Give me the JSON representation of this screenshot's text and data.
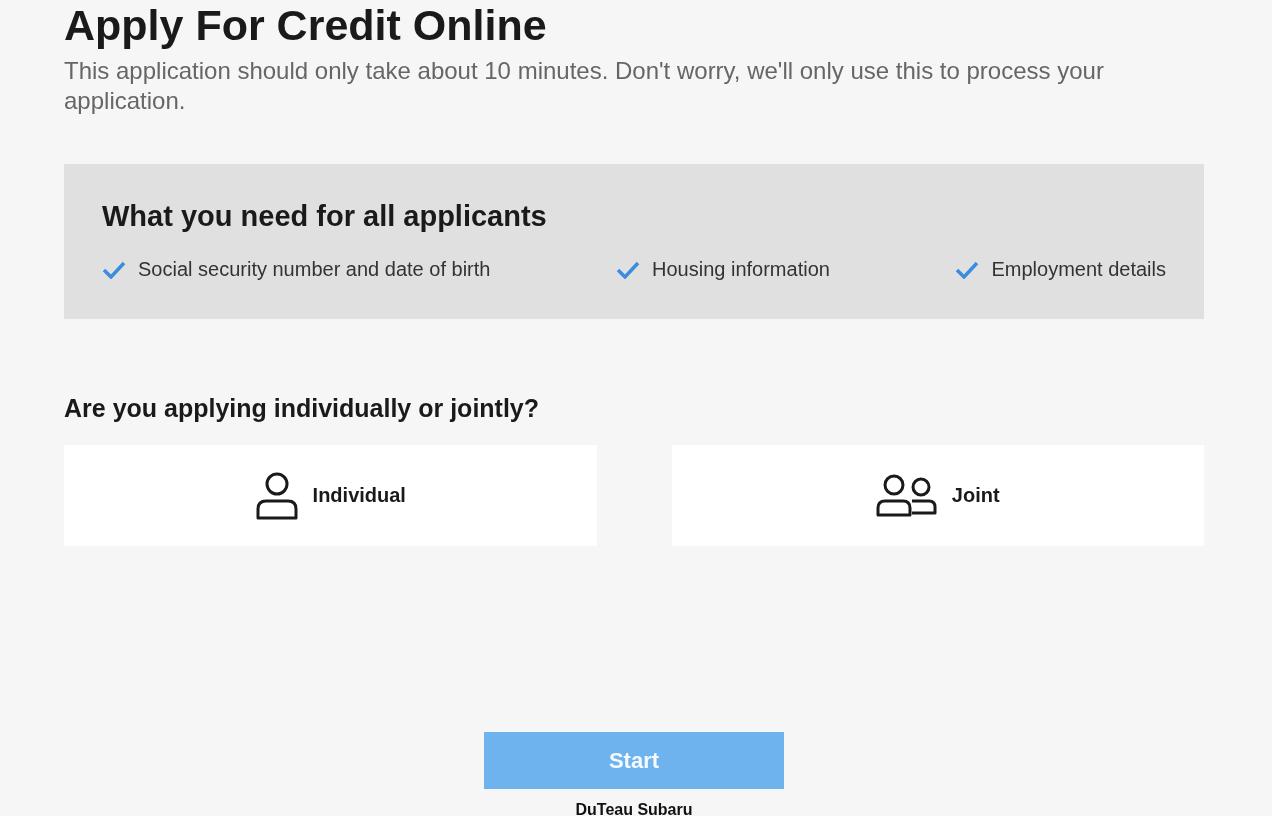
{
  "title": "Apply For Credit Online",
  "subtitle": "This application should only take about 10 minutes. Don't worry, we'll only use this to process your application.",
  "requirements": {
    "heading": "What you need for all applicants",
    "items": [
      "Social security number and date of birth",
      "Housing information",
      "Employment details"
    ]
  },
  "question": "Are you applying individually or jointly?",
  "options": [
    {
      "kind": "individual",
      "label": "Individual",
      "selected": false
    },
    {
      "kind": "joint",
      "label": "Joint",
      "selected": false
    }
  ],
  "start_button": {
    "label": "Start",
    "disabled": true
  },
  "footer": "DuTeau Subaru"
}
